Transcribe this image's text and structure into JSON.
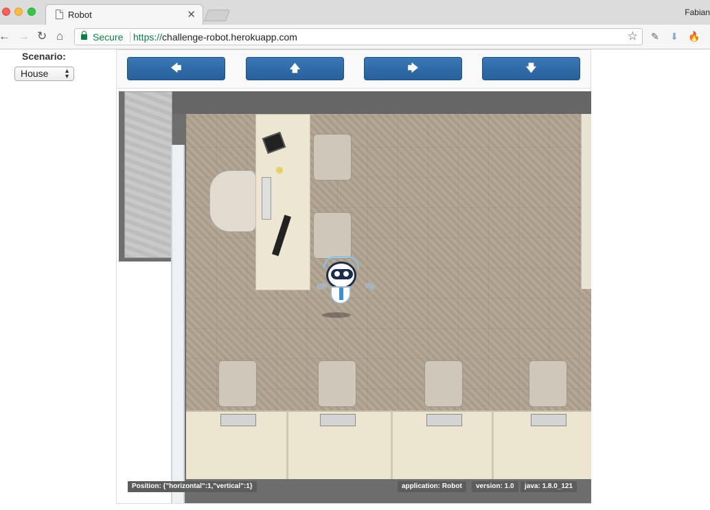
{
  "browser": {
    "tab_title": "Robot",
    "tab_close": "✕",
    "profile_name": "Fabian",
    "secure_label": "Secure",
    "url_scheme": "https://",
    "url_host": "challenge-robot.herokuapp.com"
  },
  "icons": {
    "back": "←",
    "forward": "→",
    "reload": "↻",
    "home": "⌂",
    "star": "☆",
    "dropper": "✎",
    "download": "⬇",
    "fire": "🔥"
  },
  "scenario": {
    "label": "Scenario:",
    "selected": "House",
    "arrows": "▲\n▼"
  },
  "controls": {
    "left": "🡄",
    "up": "🡅",
    "right": "🡆",
    "down": "🡇"
  },
  "status": {
    "position": "Position: {\"horizontal\":1,\"vertical\":1}",
    "application": "application: Robot",
    "version": "version: 1.0",
    "java": "java: 1.8.0_121"
  }
}
